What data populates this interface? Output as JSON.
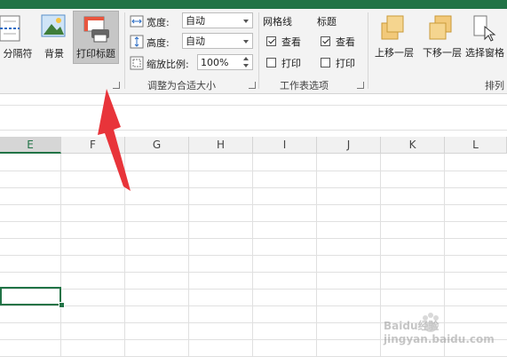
{
  "ribbon": {
    "breaks_label": "分隔符",
    "background_label": "背景",
    "print_titles_label": "打印标题",
    "width_label": "宽度:",
    "width_value": "自动",
    "height_label": "高度:",
    "height_value": "自动",
    "scale_label": "缩放比例:",
    "scale_value": "100%",
    "scale_group_label": "调整为合适大小",
    "gridlines_label": "网格线",
    "gridlines_view_label": "查看",
    "gridlines_print_label": "打印",
    "gridlines_view_checked": true,
    "gridlines_print_checked": false,
    "headings_label": "标题",
    "headings_view_label": "查看",
    "headings_print_label": "打印",
    "headings_view_checked": true,
    "headings_print_checked": false,
    "sheet_options_group_label": "工作表选项",
    "bring_forward_label": "上移一层",
    "send_backward_label": "下移一层",
    "selection_pane_label": "选择窗格",
    "arrange_group_label": "排列"
  },
  "columns": [
    "E",
    "F",
    "G",
    "H",
    "I",
    "J",
    "K",
    "L"
  ],
  "selected_column": "E",
  "watermark": "Baidu经验 jingyan.baidu.com"
}
